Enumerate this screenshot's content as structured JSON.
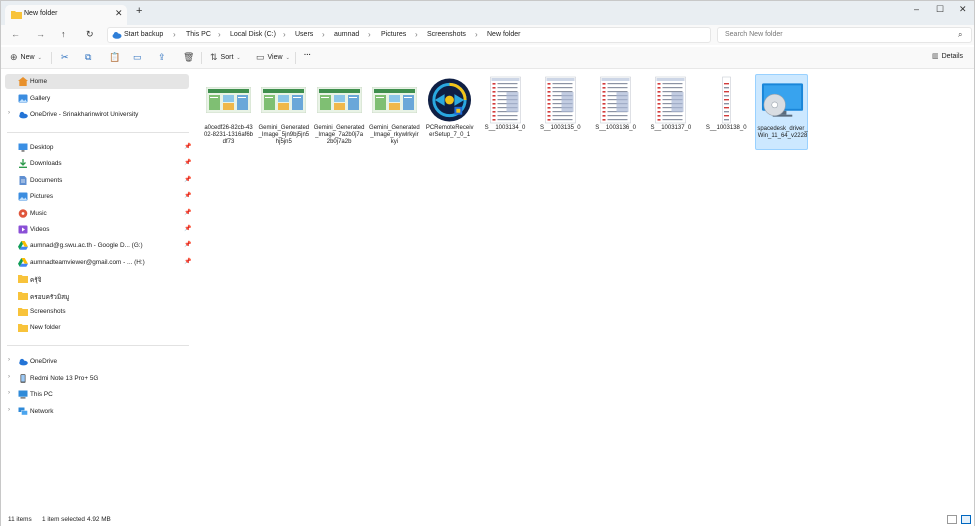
{
  "window": {
    "tab_title": "New folder",
    "new_tab_symbol": "+",
    "controls": [
      "–",
      "☐",
      "✕"
    ]
  },
  "nav": {
    "breadcrumbs": [
      "Start backup",
      "This PC",
      "Local Disk (C:)",
      "Users",
      "aumnad",
      "Pictures",
      "Screenshots",
      "New folder"
    ],
    "search_placeholder": "Search New folder"
  },
  "toolbar": {
    "new_label": "New",
    "sort_label": "Sort",
    "view_label": "View",
    "more_label": "···",
    "details_label": "Details"
  },
  "sidebar": {
    "top": [
      {
        "label": "Home",
        "icon": "home-icon",
        "selected": true
      },
      {
        "label": "Gallery",
        "icon": "gallery-icon"
      },
      {
        "label": "OneDrive - Srinakharinwirot University",
        "icon": "onedrive-icon",
        "expandable": true
      }
    ],
    "quick": [
      {
        "label": "Desktop",
        "icon": "desktop-icon",
        "pinned": true
      },
      {
        "label": "Downloads",
        "icon": "downloads-icon",
        "pinned": true
      },
      {
        "label": "Documents",
        "icon": "documents-icon",
        "pinned": true
      },
      {
        "label": "Pictures",
        "icon": "pictures-icon",
        "pinned": true
      },
      {
        "label": "Music",
        "icon": "music-icon",
        "pinned": true
      },
      {
        "label": "Videos",
        "icon": "videos-icon",
        "pinned": true
      },
      {
        "label": "aumnad@g.swu.ac.th - Google D... (G:)",
        "icon": "google-drive-icon",
        "pinned": true
      },
      {
        "label": "aumnadteamviewer@gmail.com - ... (H:)",
        "icon": "google-drive-icon",
        "pinned": true
      },
      {
        "label": "ครุ้จิ",
        "icon": "folder-icon"
      },
      {
        "label": "ครอบครัวมิสมู",
        "icon": "folder-icon"
      },
      {
        "label": "Screenshots",
        "icon": "folder-icon"
      },
      {
        "label": "New folder",
        "icon": "folder-icon"
      }
    ],
    "bottom": [
      {
        "label": "OneDrive",
        "icon": "cloud-icon",
        "expandable": true
      },
      {
        "label": "Redmi Note 13 Pro+ 5G",
        "icon": "phone-icon",
        "expandable": true
      },
      {
        "label": "This PC",
        "icon": "pc-icon",
        "expandable": true
      },
      {
        "label": "Network",
        "icon": "network-icon",
        "expandable": true
      }
    ]
  },
  "files": [
    {
      "name": "a0cedf26-82cb-4302-8231-1316af6bdf73",
      "kind": "slide"
    },
    {
      "name": "Gemini_Generated_Image_5jn9bj5jn5hj5jn5",
      "kind": "slide"
    },
    {
      "name": "Gemini_Generated_Image_7a2b0j7a2b0j7a2b",
      "kind": "slide"
    },
    {
      "name": "Gemini_Generated_Image_rkywlrkyirkyi",
      "kind": "slide"
    },
    {
      "name": "PCRemoteReceiverSetup_7_0_1",
      "kind": "installer"
    },
    {
      "name": "S__1003134_0",
      "kind": "phone"
    },
    {
      "name": "S__1003135_0",
      "kind": "phone"
    },
    {
      "name": "S__1003136_0",
      "kind": "phone"
    },
    {
      "name": "S__1003137_0",
      "kind": "phone"
    },
    {
      "name": "S__1003138_0",
      "kind": "phone-thin"
    },
    {
      "name": "spacedesk_driver_Win_11_64_v2228",
      "kind": "disc",
      "selected": true
    }
  ],
  "status": {
    "count": "11 items",
    "selection": "1 item selected",
    "size": "4.92 MB"
  },
  "colors": {
    "accent": "#0067c0",
    "selection_bg": "#cce8ff",
    "selection_border": "#99d1ff",
    "folder": "#f8c33b"
  }
}
